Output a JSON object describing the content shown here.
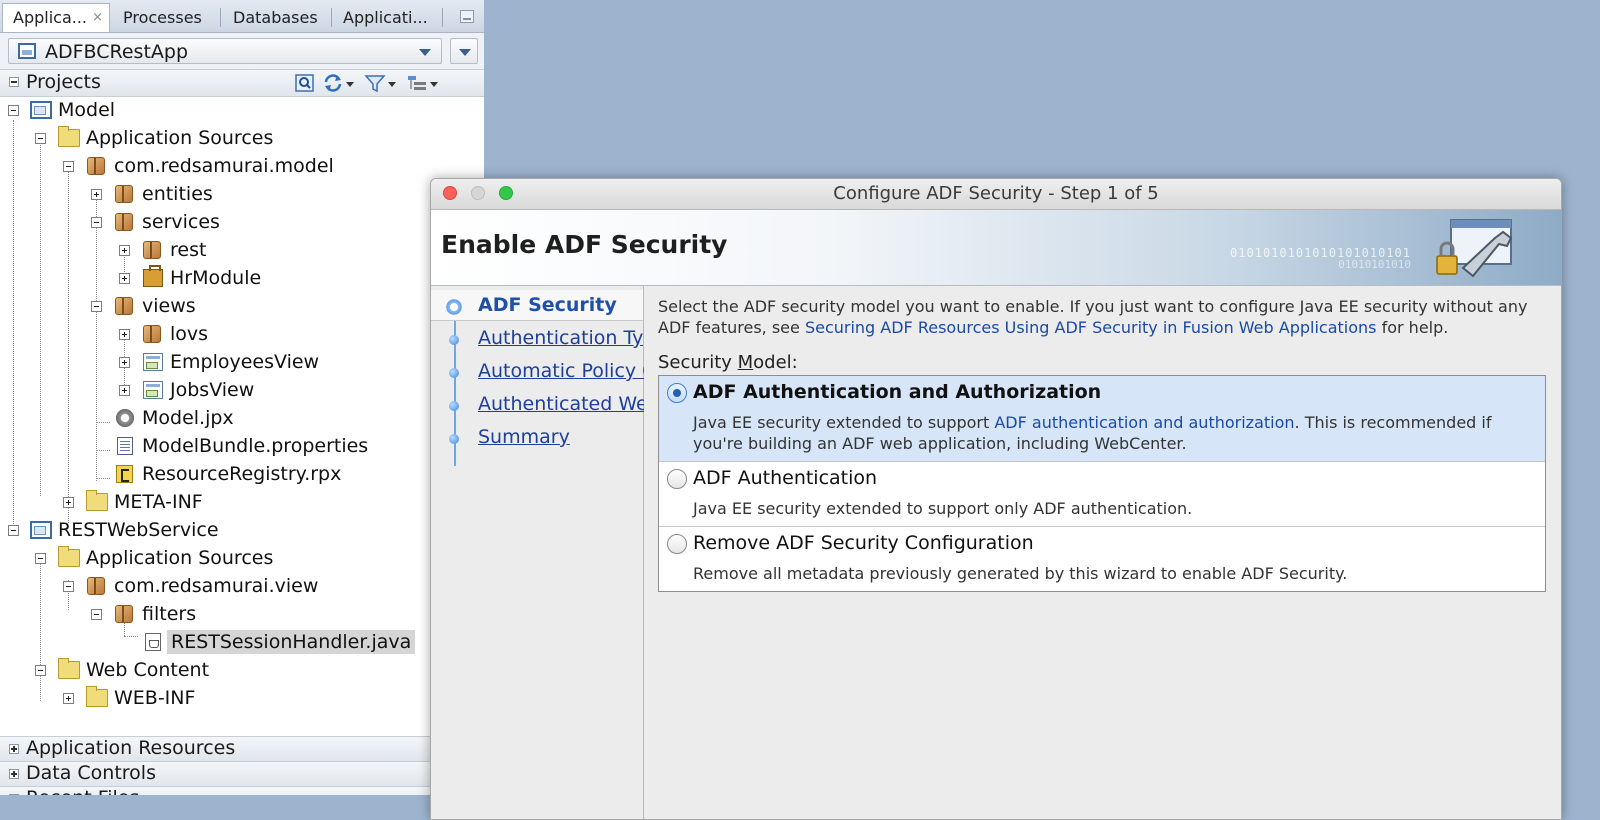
{
  "navigator": {
    "tabs": [
      {
        "label": "Applica...",
        "close": "×"
      },
      {
        "label": "Processes"
      },
      {
        "label": "Databases"
      },
      {
        "label": "Applicati..."
      }
    ],
    "application": "ADFBCRestApp",
    "projects_label": "Projects",
    "tree": [
      {
        "label": "Model"
      },
      {
        "label": "Application Sources"
      },
      {
        "label": "com.redsamurai.model"
      },
      {
        "label": "entities"
      },
      {
        "label": "services"
      },
      {
        "label": "rest"
      },
      {
        "label": "HrModule"
      },
      {
        "label": "views"
      },
      {
        "label": "lovs"
      },
      {
        "label": "EmployeesView"
      },
      {
        "label": "JobsView"
      },
      {
        "label": "Model.jpx"
      },
      {
        "label": "ModelBundle.properties"
      },
      {
        "label": "ResourceRegistry.rpx"
      },
      {
        "label": "META-INF"
      },
      {
        "label": "RESTWebService"
      },
      {
        "label": "Application Sources"
      },
      {
        "label": "com.redsamurai.view"
      },
      {
        "label": "filters"
      },
      {
        "label": "RESTSessionHandler.java"
      },
      {
        "label": "Web Content"
      },
      {
        "label": "WEB-INF"
      }
    ],
    "accordions": [
      "Application Resources",
      "Data Controls",
      "Recent Files"
    ]
  },
  "dialog": {
    "title": "Configure ADF Security - Step 1 of 5",
    "header": "Enable ADF Security",
    "banner_bits": "0101010101010101010101",
    "banner_bits2": "01010101010",
    "steps": [
      "ADF Security",
      "Authentication Type",
      "Automatic Policy Grants",
      "Authenticated Welcome",
      "Summary"
    ],
    "intro_text_1": "Select the ADF security model you want to enable. If you just want to configure Java EE security without any ADF features, see ",
    "intro_link": "Securing ADF Resources Using ADF Security in Fusion Web Applications",
    "intro_text_2": " for help.",
    "security_model_pre": "Security ",
    "security_model_mnemonic": "M",
    "security_model_post": "odel:",
    "options": [
      {
        "title": "ADF Authentication and Authorization",
        "desc_1": "Java EE security extended to support ",
        "desc_link": "ADF authentication and authorization",
        "desc_2": ". This is recommended if you're building an ADF web application, including WebCenter.",
        "selected": true
      },
      {
        "title": "ADF Authentication",
        "desc_1": "Java EE security extended to support only ADF authentication.",
        "selected": false
      },
      {
        "title": "Remove ADF Security Configuration",
        "desc_1": "Remove all metadata previously generated by this wizard to enable ADF Security.",
        "selected": false
      }
    ]
  }
}
